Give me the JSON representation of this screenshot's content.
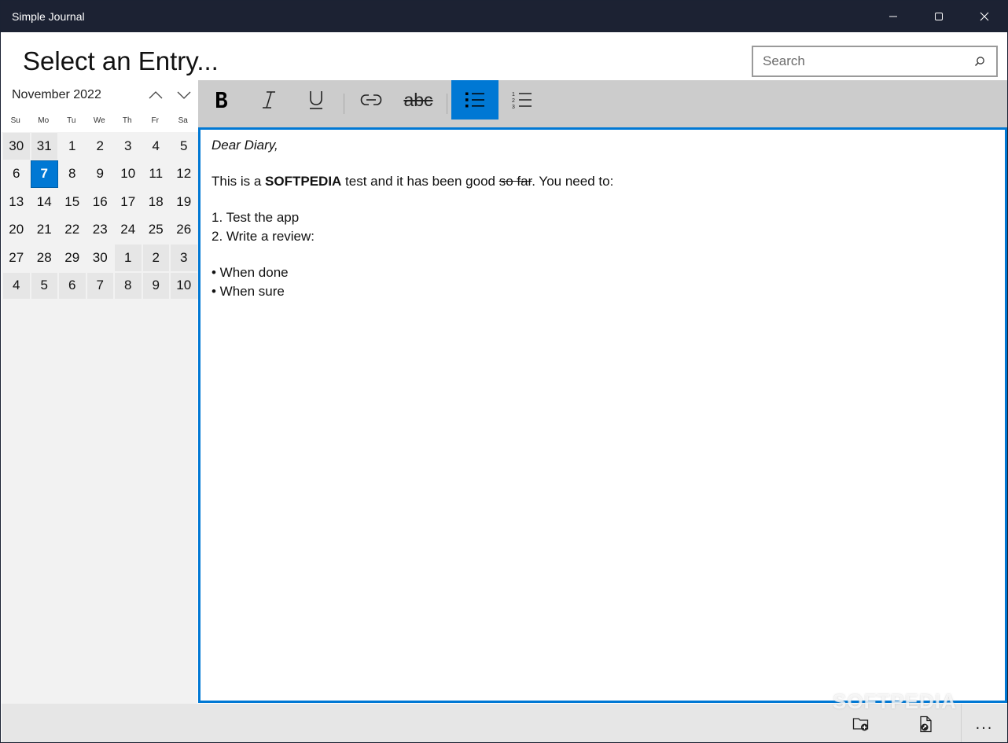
{
  "window": {
    "title": "Simple Journal",
    "controls": [
      "minimize",
      "maximize",
      "close"
    ]
  },
  "header": {
    "title": "Select an Entry...",
    "search": {
      "placeholder": "Search",
      "value": ""
    }
  },
  "calendar": {
    "month_label": "November 2022",
    "weekdays": [
      "Su",
      "Mo",
      "Tu",
      "We",
      "Th",
      "Fr",
      "Sa"
    ],
    "selected_day": "7",
    "weeks": [
      [
        {
          "d": "30",
          "m": "out"
        },
        {
          "d": "31",
          "m": "out"
        },
        {
          "d": "1",
          "m": "in"
        },
        {
          "d": "2",
          "m": "in"
        },
        {
          "d": "3",
          "m": "in"
        },
        {
          "d": "4",
          "m": "in"
        },
        {
          "d": "5",
          "m": "in"
        }
      ],
      [
        {
          "d": "6",
          "m": "in"
        },
        {
          "d": "7",
          "m": "sel"
        },
        {
          "d": "8",
          "m": "in"
        },
        {
          "d": "9",
          "m": "in"
        },
        {
          "d": "10",
          "m": "in"
        },
        {
          "d": "11",
          "m": "in"
        },
        {
          "d": "12",
          "m": "in"
        }
      ],
      [
        {
          "d": "13",
          "m": "in"
        },
        {
          "d": "14",
          "m": "in"
        },
        {
          "d": "15",
          "m": "in"
        },
        {
          "d": "16",
          "m": "in"
        },
        {
          "d": "17",
          "m": "in"
        },
        {
          "d": "18",
          "m": "in"
        },
        {
          "d": "19",
          "m": "in"
        }
      ],
      [
        {
          "d": "20",
          "m": "in"
        },
        {
          "d": "21",
          "m": "in"
        },
        {
          "d": "22",
          "m": "in"
        },
        {
          "d": "23",
          "m": "in"
        },
        {
          "d": "24",
          "m": "in"
        },
        {
          "d": "25",
          "m": "in"
        },
        {
          "d": "26",
          "m": "in"
        }
      ],
      [
        {
          "d": "27",
          "m": "in"
        },
        {
          "d": "28",
          "m": "in"
        },
        {
          "d": "29",
          "m": "in"
        },
        {
          "d": "30",
          "m": "in"
        },
        {
          "d": "1",
          "m": "out"
        },
        {
          "d": "2",
          "m": "out"
        },
        {
          "d": "3",
          "m": "out"
        }
      ],
      [
        {
          "d": "4",
          "m": "out"
        },
        {
          "d": "5",
          "m": "out"
        },
        {
          "d": "6",
          "m": "out"
        },
        {
          "d": "7",
          "m": "out"
        },
        {
          "d": "8",
          "m": "out"
        },
        {
          "d": "9",
          "m": "out"
        },
        {
          "d": "10",
          "m": "out"
        }
      ]
    ]
  },
  "toolbar": {
    "buttons": [
      {
        "name": "bold",
        "icon": "bold-icon",
        "active": false
      },
      {
        "name": "italic",
        "icon": "italic-icon",
        "active": false
      },
      {
        "name": "underline",
        "icon": "underline-icon",
        "active": false
      },
      {
        "name": "link",
        "icon": "link-icon",
        "active": false
      },
      {
        "name": "strikethrough",
        "icon": "strikethrough-icon",
        "active": false,
        "label": "abc"
      },
      {
        "name": "bulleted-list",
        "icon": "bulleted-list-icon",
        "active": true
      },
      {
        "name": "numbered-list",
        "icon": "numbered-list-icon",
        "active": false
      }
    ]
  },
  "editor": {
    "greeting": "Dear Diary,",
    "line2": {
      "pre": "This is a ",
      "bold": "SOFTPEDIA",
      "mid": " test and it has been good ",
      "strike": "so far",
      "post": ". You need to:"
    },
    "numbered": [
      "1. Test the app",
      "2. Write a review:"
    ],
    "bullets": [
      "• When done",
      "• When sure"
    ]
  },
  "bottom_bar": {
    "buttons": [
      {
        "name": "new-folder",
        "icon": "folder-add-icon"
      },
      {
        "name": "open-file",
        "icon": "file-open-icon"
      },
      {
        "name": "more",
        "icon": "more-icon",
        "label": "..."
      }
    ]
  },
  "watermark": "SOFTPEDIA",
  "colors": {
    "titlebar": "#1c2233",
    "accent": "#0078d4",
    "toolbar": "#cccccc",
    "calendar_bg": "#f2f2f2",
    "bottombar": "#e6e6e6"
  }
}
